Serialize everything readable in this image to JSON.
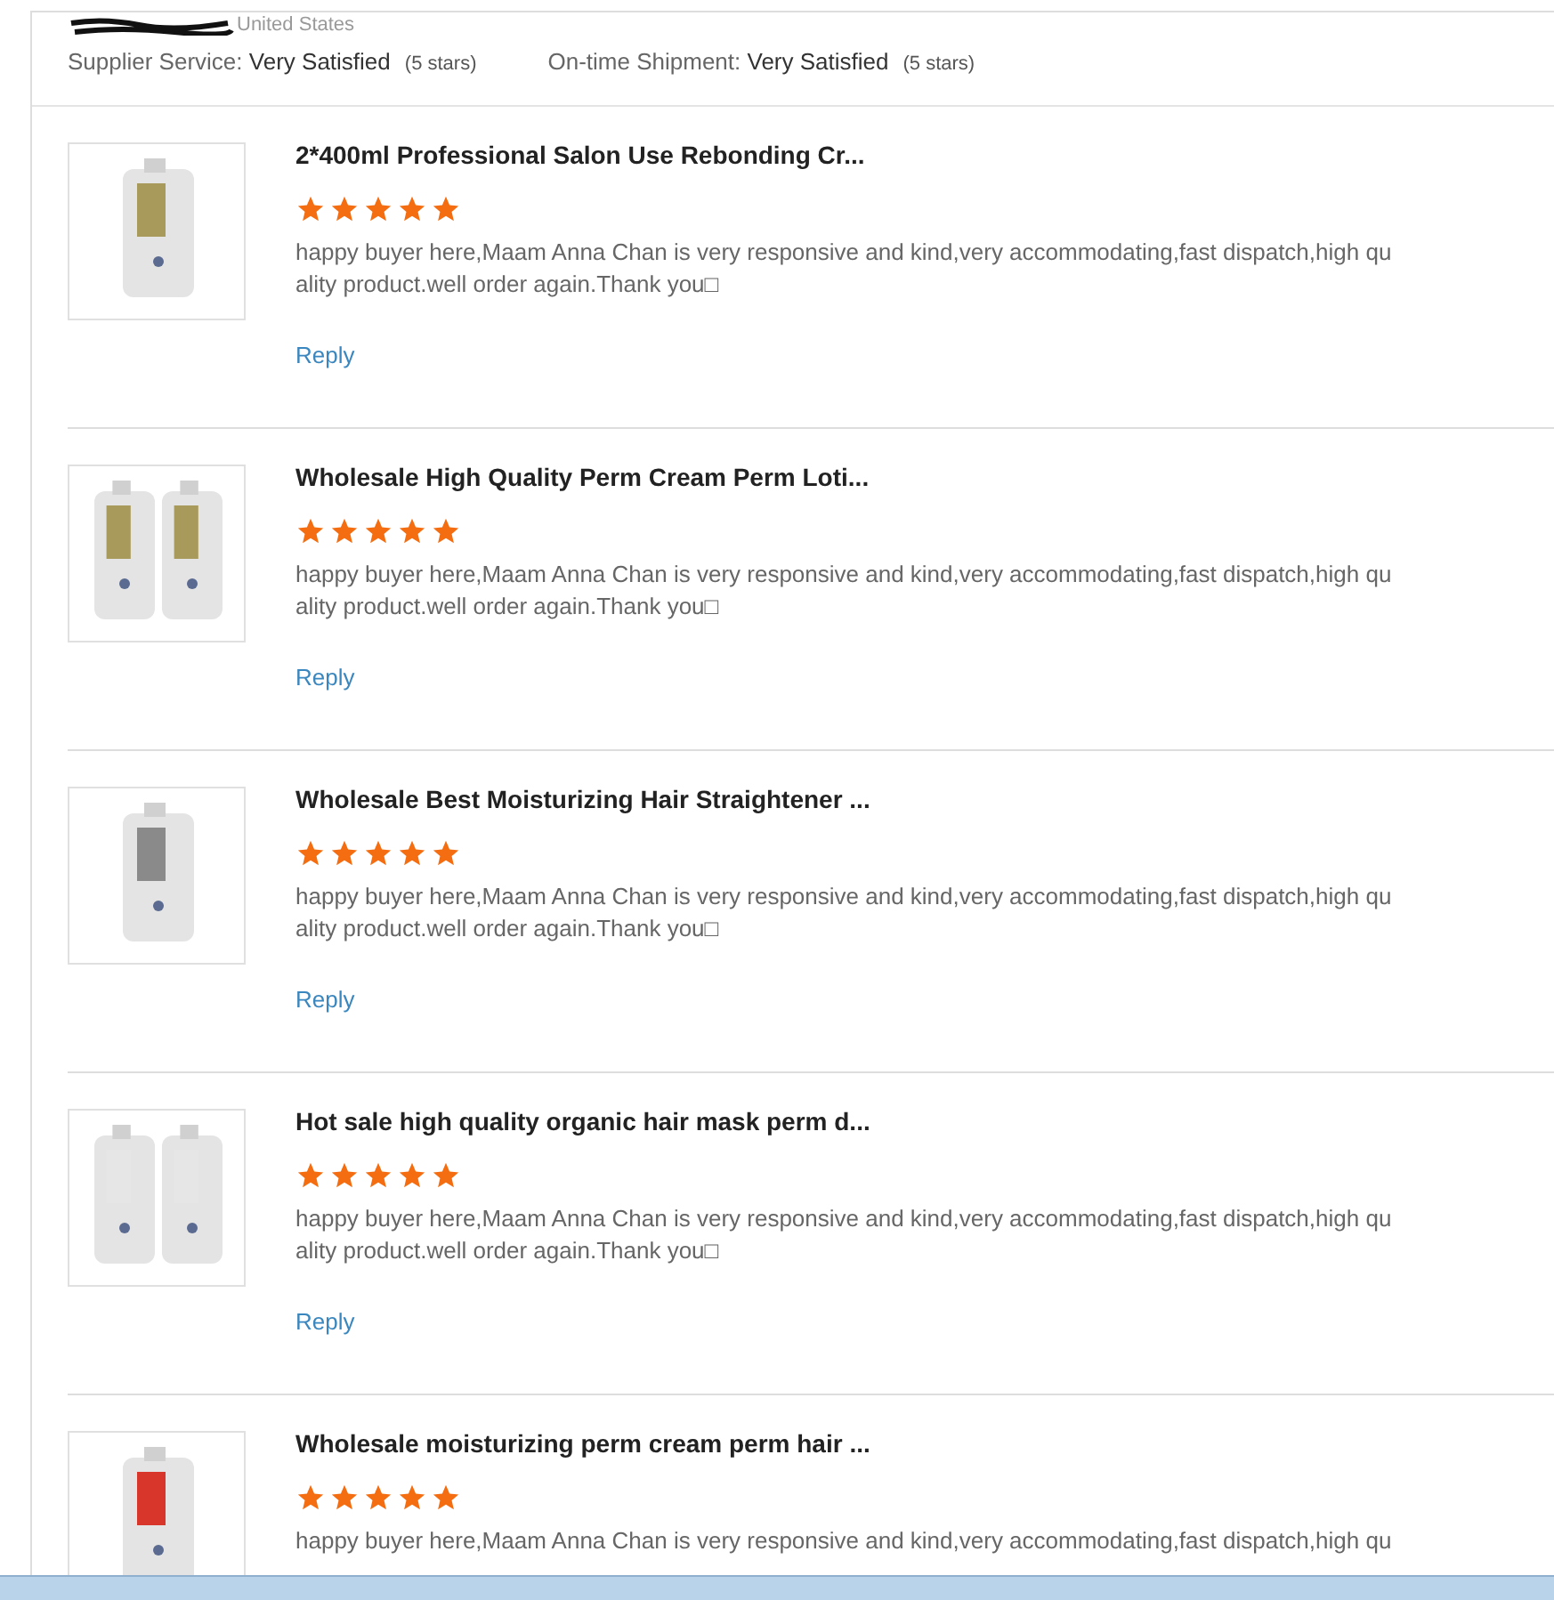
{
  "header": {
    "location": "United States",
    "ratings": [
      {
        "label": "Supplier Service:",
        "value": "Very Satisfied",
        "note": "(5 stars)"
      },
      {
        "label": "On-time Shipment:",
        "value": "Very Satisfied",
        "note": "(5 stars)"
      }
    ]
  },
  "reviews": [
    {
      "product": {
        "kind": "picture"
      },
      "title": "2*400ml Professional Salon Use Rebonding Cr...",
      "stars": 5,
      "comment": [
        "happy buyer here,Maam Anna Chan is very responsive and kind,very accommodating,fast dispatch,high qu",
        "ality product.well order again.Thank you□"
      ],
      "reply": "Reply"
    },
    {
      "product": {
        "kind": "picture"
      },
      "title": "Wholesale High Quality Perm Cream Perm Loti...",
      "stars": 5,
      "comment": [
        "happy buyer here,Maam Anna Chan is very responsive and kind,very accommodating,fast dispatch,high qu",
        "ality product.well order again.Thank you□"
      ],
      "reply": "Reply"
    },
    {
      "product": {
        "kind": "picture"
      },
      "title": "Wholesale Best Moisturizing Hair Straightener ...",
      "stars": 5,
      "comment": [
        "happy buyer here,Maam Anna Chan is very responsive and kind,very accommodating,fast dispatch,high qu",
        "ality product.well order again.Thank you□"
      ],
      "reply": "Reply"
    },
    {
      "product": {
        "kind": "picture"
      },
      "title": "Hot sale high quality organic hair mask perm d...",
      "stars": 5,
      "comment": [
        "happy buyer here,Maam Anna Chan is very responsive and kind,very accommodating,fast dispatch,high qu",
        "ality product.well order again.Thank you□"
      ],
      "reply": "Reply"
    },
    {
      "product": {
        "kind": "picture"
      },
      "title": "Wholesale moisturizing perm cream perm hair ...",
      "stars": 5,
      "comment": [
        "happy buyer here,Maam Anna Chan is very responsive and kind,very accommodating,fast dispatch,high qu"
      ]
    }
  ]
}
